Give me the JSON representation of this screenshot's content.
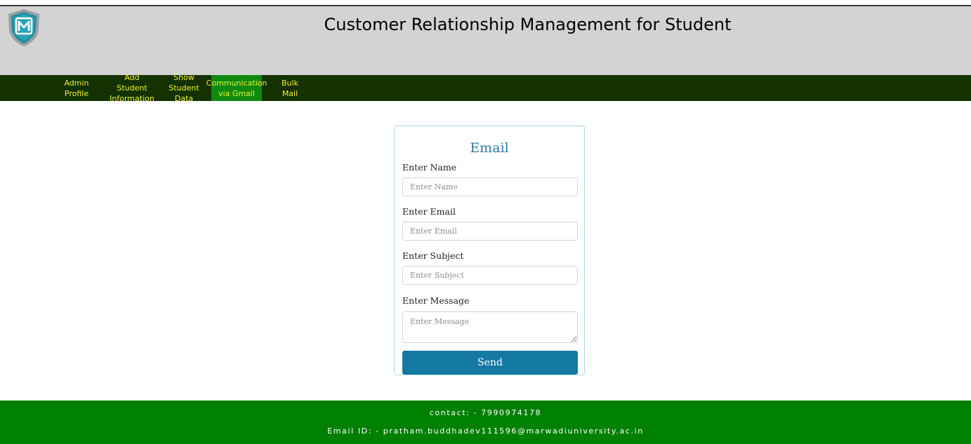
{
  "header": {
    "title": "Customer Relationship Management for Student",
    "logo_icon": "university-shield-logo",
    "logo_letter": "M"
  },
  "nav": {
    "items": [
      {
        "line1": "Admin",
        "line2": "Profile",
        "active": false
      },
      {
        "line1": "Add Student",
        "line2": "Information",
        "active": false
      },
      {
        "line1": "Show Student",
        "line2": "Data",
        "active": false
      },
      {
        "line1": "Communication",
        "line2": "via Gmail",
        "active": true
      },
      {
        "line1": "Bulk",
        "line2": "Mail",
        "active": false
      }
    ]
  },
  "form": {
    "title": "Email",
    "name_label": "Enter Name",
    "name_placeholder": "Enter Name",
    "email_label": "Enter Email",
    "email_placeholder": "Enter Email",
    "subject_label": "Enter Subject",
    "subject_placeholder": "Enter Subject",
    "message_label": "Enter Message",
    "message_placeholder": "Enter Message",
    "send_label": "Send"
  },
  "footer": {
    "contact": "contact: - 7990974178",
    "email": "Email ID: - pratham.buddhadev111596@marwadiuniversity.ac.in"
  },
  "colors": {
    "header_bg": "#d3d3d3",
    "nav_bg": "#133200",
    "nav_text": "#f3ef36",
    "nav_active_bg": "#0f8a0f",
    "accent": "#1479a3",
    "footer_bg": "#008000"
  }
}
